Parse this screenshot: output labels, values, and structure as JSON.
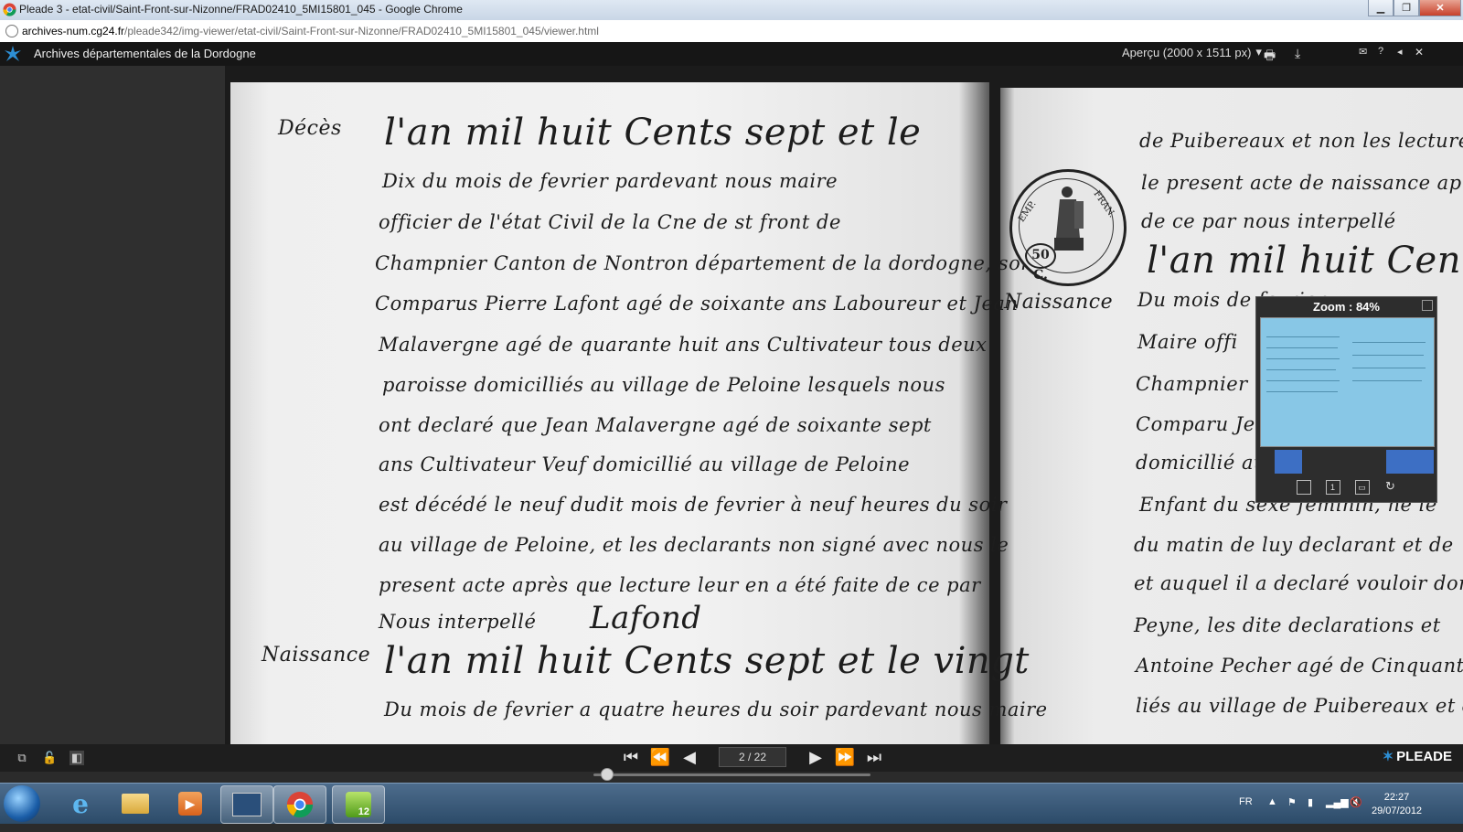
{
  "window": {
    "title": "Pleade 3 - etat-civil/Saint-Front-sur-Nizonne/FRAD02410_5MI15801_045 - Google Chrome"
  },
  "address": {
    "host": "archives-num.cg24.fr",
    "path": "/pleade342/img-viewer/etat-civil/Saint-Front-sur-Nizonne/FRAD02410_5MI15801_045/viewer.html"
  },
  "app": {
    "title": "Archives départementales de la Dordogne",
    "preview_label": "Aperçu (2000 x 1511 px)"
  },
  "document": {
    "left_margin": [
      "Décès",
      "Naissance"
    ],
    "left_lines": [
      "l'an mil huit Cents sept et le",
      "Dix du mois de fevrier pardevant nous maire",
      "officier de l'état Civil de la Cne de st front de",
      "Champnier Canton de Nontron département de la dordogne, sont",
      "Comparus Pierre Lafont agé de soixante ans Laboureur et Jean",
      "Malavergne agé de quarante huit ans Cultivateur tous deux",
      "paroisse domicilliés au village de Peloine lesquels nous",
      "ont declaré que Jean Malavergne agé de soixante sept",
      "ans Cultivateur Veuf domicillié au village de Peloine",
      "est décédé le neuf dudit mois de fevrier à neuf heures du soir",
      "au village de Peloine, et les declarants non signé avec nous le",
      "present acte après que lecture leur en a été faite de ce par",
      "Nous interpellé",
      "l'an mil huit Cents sept et le vingt",
      "Du mois de fevrier a quatre heures du soir pardevant nous maire"
    ],
    "signature": "Lafond",
    "right_margin": "Naissance",
    "right_lines": [
      "de Puibereaux et non les lecture",
      "le present acte de naissance apres",
      "de ce par nous interpellé",
      "l'an mil huit Cent",
      "Du mois de fevrier",
      "Maire offi",
      "Champnier",
      "Comparu Jea",
      "domicillié au",
      "Enfant du sexe feminin, ne le",
      "du matin de luy declarant et de",
      "et auquel il a declaré vouloir don",
      "Peyne, les dite declarations et",
      "Antoine Pecher agé de Cinquante",
      "liés au village de Puibereaux et de"
    ],
    "stamp": {
      "left_text": "EMP.",
      "right_text": "FRAN.",
      "value": "50 C."
    }
  },
  "zoom": {
    "label": "Zoom : 84%"
  },
  "pager": {
    "current": "2 / 22",
    "position": 0.05
  },
  "branding": {
    "name": "PLEADE"
  },
  "taskbar": {
    "language": "FR",
    "time": "22:27",
    "date": "29/07/2012",
    "app_badge": "12"
  },
  "colors": {
    "zoom_highlight": "#4fb4e6",
    "close_red": "#c7402a",
    "pleade_blue": "#2d8fd5"
  }
}
